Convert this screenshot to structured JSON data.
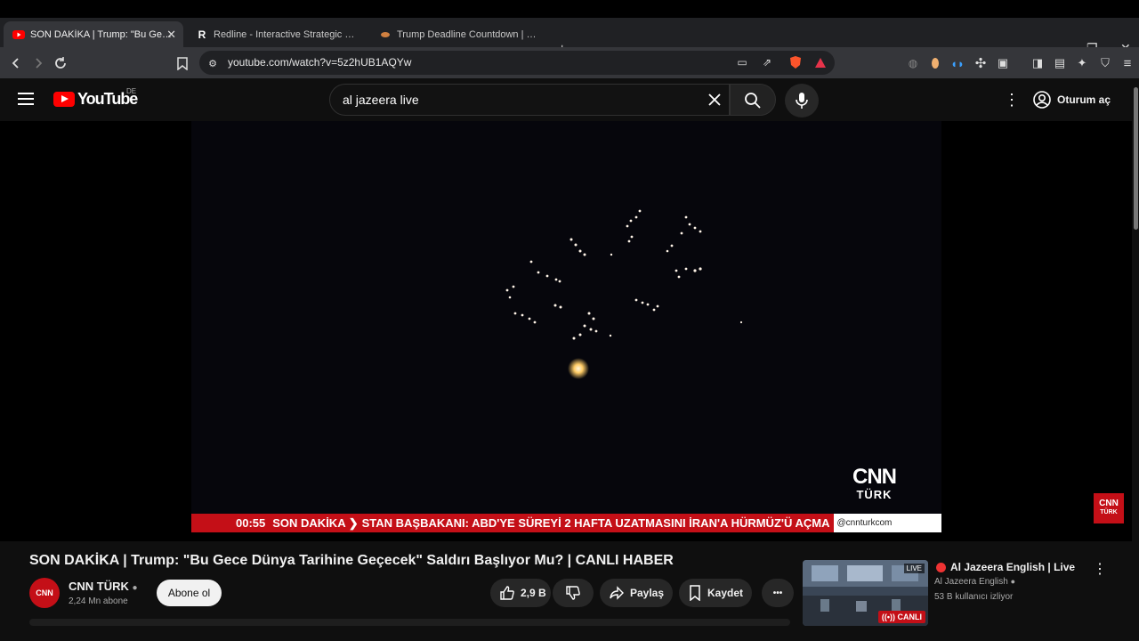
{
  "browser": {
    "tabs": [
      {
        "title": "SON DAKİKA | Trump: \"Bu Gece Dünya",
        "active": true,
        "icon": "youtube-icon"
      },
      {
        "title": "Redline - Interactive Strategic Map",
        "active": false,
        "icon": "redline-icon"
      },
      {
        "title": "Trump Deadline Countdown | CENTC",
        "active": false,
        "icon": "countdown-icon"
      }
    ],
    "new_tab": "+",
    "url": "youtube.com/watch?v=5z2hUB1AQYw"
  },
  "youtube": {
    "logo_text": "YouTube",
    "country": "DE",
    "search_query": "al jazeera live",
    "sign_in": "Oturum aç"
  },
  "video": {
    "ticker_time": "00:55",
    "ticker_label": "SON DAKİKA ❯",
    "ticker_text": "STAN BAŞBAKANI: ABD'YE SÜREYİ 2 HAFTA UZATMASINI İRAN'A HÜRMÜZ'Ü AÇMA",
    "ticker_handle": "@cnnturkcom",
    "logo_top": "CNN",
    "logo_bottom": "TÜRK",
    "bug_top": "CNN",
    "bug_bottom": "TÜRK"
  },
  "details": {
    "title": "SON DAKİKA | Trump: \"Bu Gece Dünya Tarihine Geçecek\" Saldırı Başlıyor Mu? | CANLI HABER",
    "channel_name": "CNN TÜRK",
    "channel_subs": "2,24 Mn abone",
    "avatar_text": "CNN",
    "subscribe": "Abone ol",
    "likes": "2,9 B",
    "share": "Paylaş",
    "save": "Kaydet",
    "more": "•••"
  },
  "recommendation": {
    "title": "Al Jazeera English | Live",
    "channel": "Al Jazeera English",
    "viewers": "53 B kullanıcı izliyor",
    "live_badge": "LIVE",
    "canli_badge": "((•)) CANLI"
  }
}
